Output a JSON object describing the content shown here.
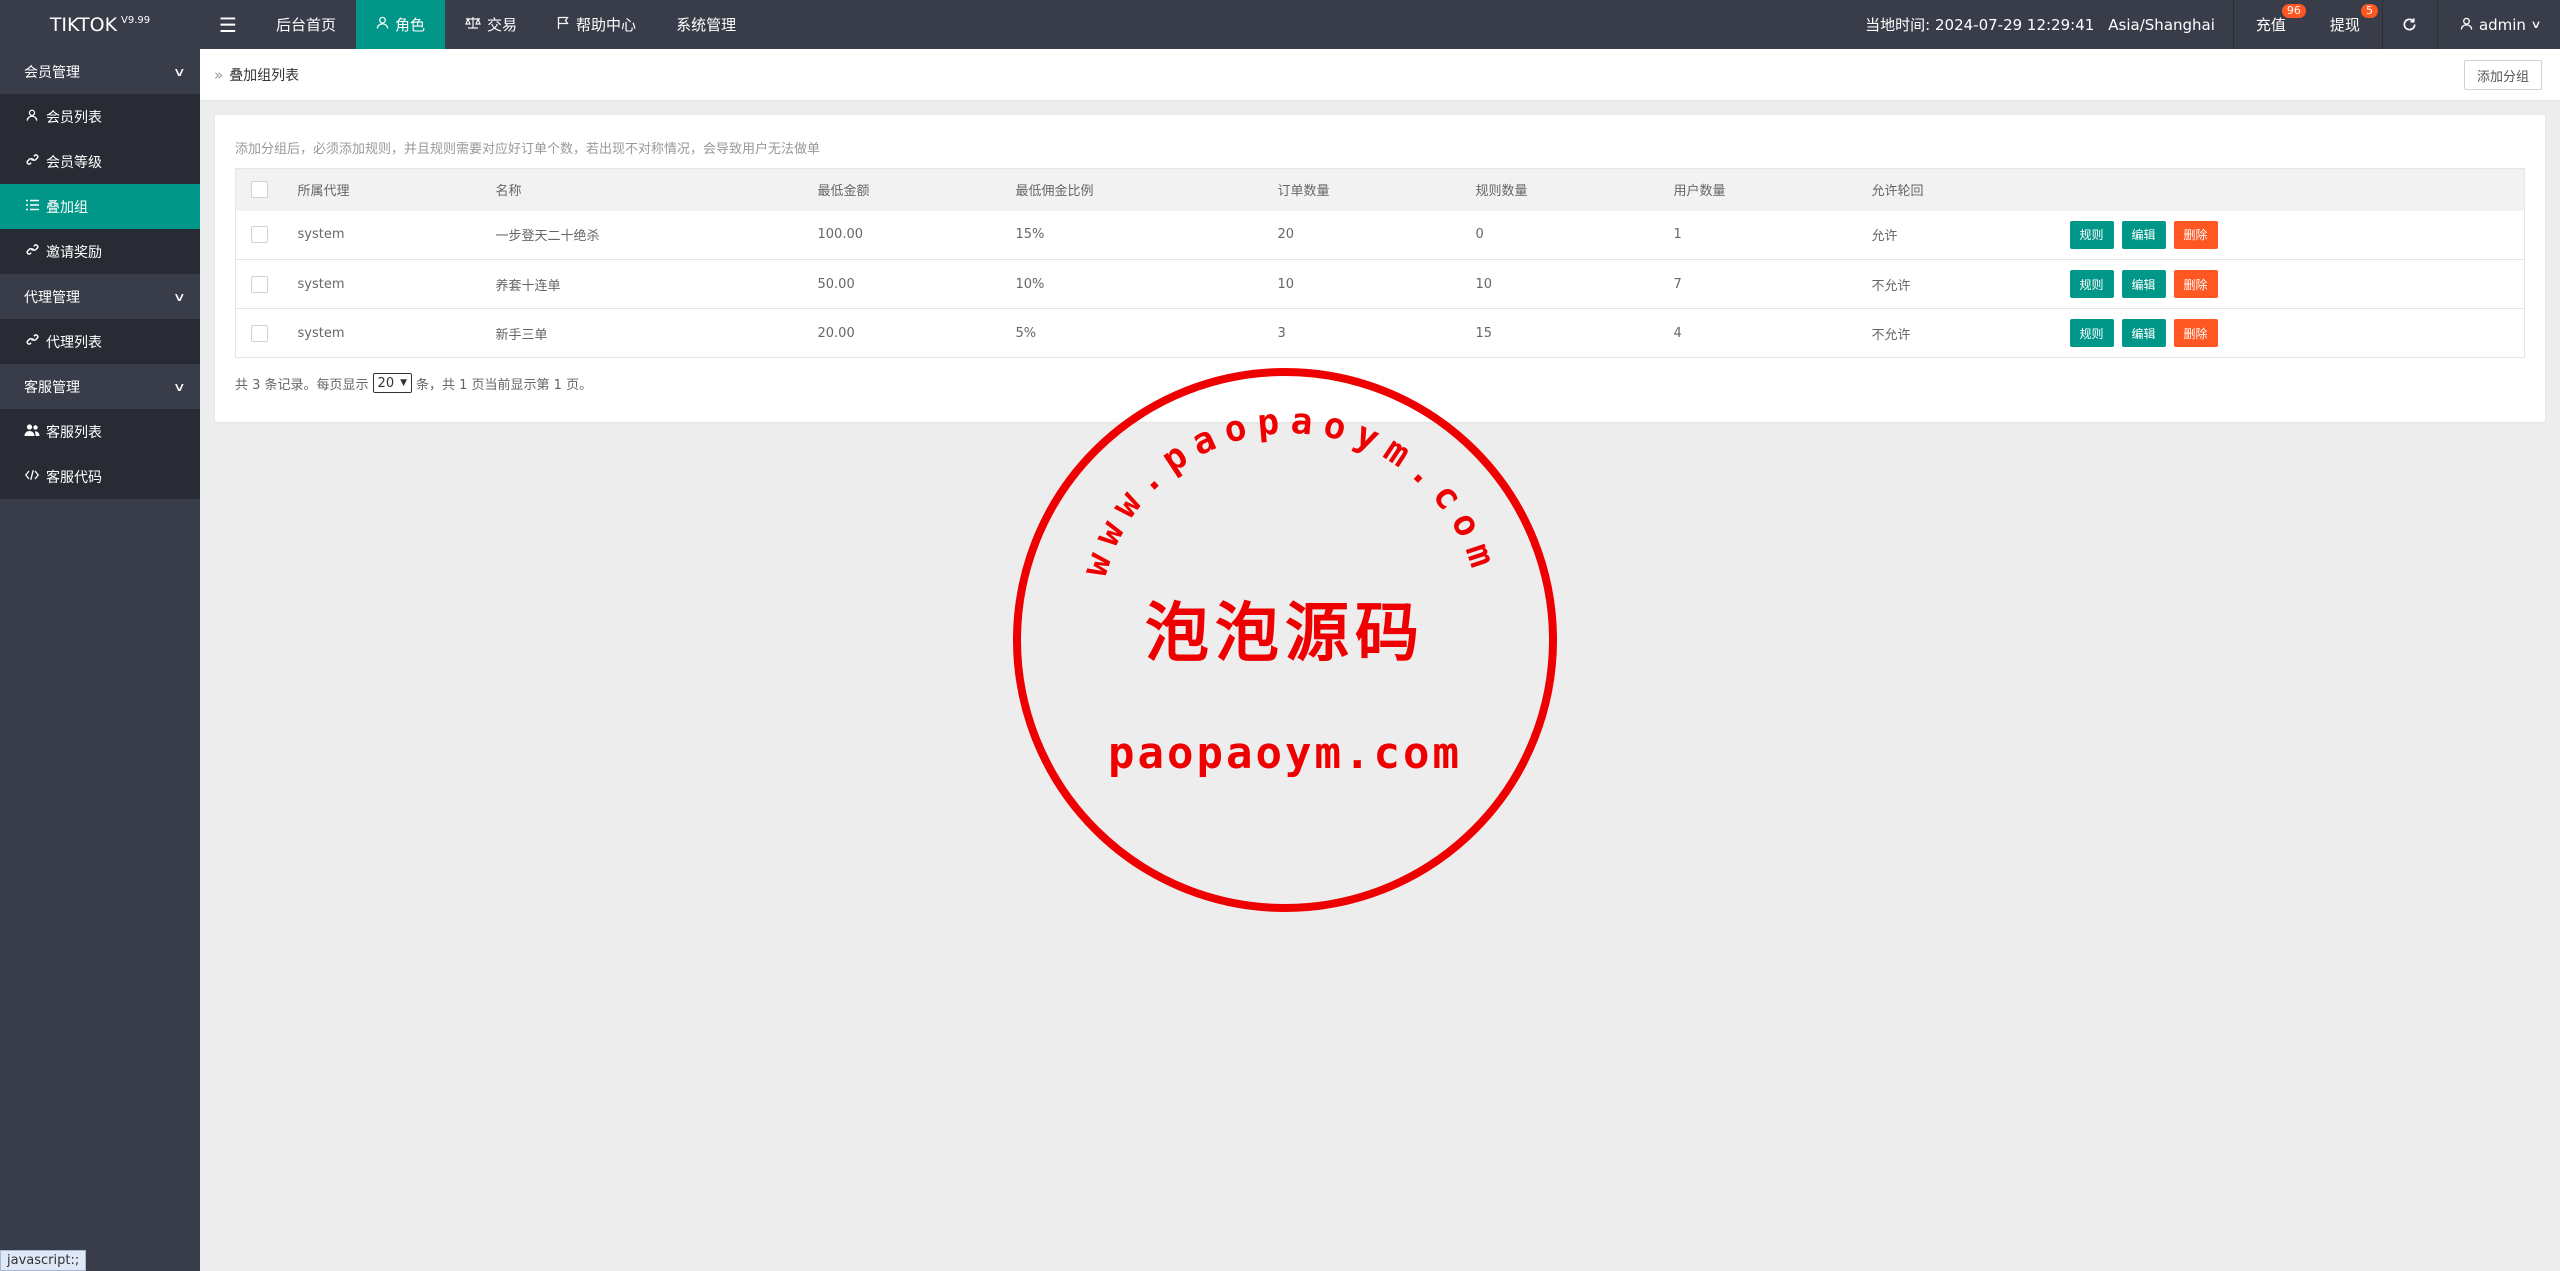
{
  "app": {
    "title": "TIKTOK",
    "version": "V9.99"
  },
  "topnav": {
    "items": [
      {
        "label": "后台首页",
        "icon": "home",
        "active": false
      },
      {
        "label": "角色",
        "icon": "user-icon",
        "active": true
      },
      {
        "label": "交易",
        "icon": "scale-icon",
        "active": false
      },
      {
        "label": "帮助中心",
        "icon": "flag-icon",
        "active": false
      },
      {
        "label": "系统管理",
        "icon": "",
        "active": false
      }
    ]
  },
  "header_right": {
    "time_label": "当地时间: 2024-07-29 12:29:41",
    "timezone": "Asia/Shanghai",
    "recharge": {
      "label": "充值",
      "count": "96"
    },
    "withdraw": {
      "label": "提现",
      "count": "5"
    },
    "user": "admin"
  },
  "sidebar": {
    "groups": [
      {
        "label": "会员管理",
        "items": [
          {
            "label": "会员列表",
            "icon": "user-icon",
            "active": false
          },
          {
            "label": "会员等级",
            "icon": "link-icon",
            "active": false
          },
          {
            "label": "叠加组",
            "icon": "list-icon",
            "active": true
          },
          {
            "label": "邀请奖励",
            "icon": "link-icon",
            "active": false
          }
        ]
      },
      {
        "label": "代理管理",
        "items": [
          {
            "label": "代理列表",
            "icon": "link-icon",
            "active": false
          }
        ]
      },
      {
        "label": "客服管理",
        "items": [
          {
            "label": "客服列表",
            "icon": "users-icon",
            "active": false
          },
          {
            "label": "客服代码",
            "icon": "code-icon",
            "active": false
          }
        ]
      }
    ]
  },
  "breadcrumb": {
    "title": "叠加组列表",
    "add_button": "添加分组"
  },
  "tip": "添加分组后，必须添加规则，并且规则需要对应好订单个数，若出现不对称情况，会导致用户无法做单",
  "table": {
    "headers": [
      "所属代理",
      "名称",
      "最低金额",
      "最低佣金比例",
      "订单数量",
      "规则数量",
      "用户数量",
      "允许轮回"
    ],
    "rows": [
      [
        "system",
        "一步登天二十绝杀",
        "100.00",
        "15%",
        "20",
        "0",
        "1",
        "允许"
      ],
      [
        "system",
        "养套十连单",
        "50.00",
        "10%",
        "10",
        "10",
        "7",
        "不允许"
      ],
      [
        "system",
        "新手三单",
        "20.00",
        "5%",
        "3",
        "15",
        "4",
        "不允许"
      ]
    ],
    "row_actions": [
      "规则",
      "编辑",
      "删除"
    ]
  },
  "pager": {
    "prefix": "共 3 条记录。每页显示",
    "page_size": "20",
    "suffix": "条，共 1 页当前显示第 1 页。"
  },
  "watermark": {
    "arc_text": "www.paopaoym.com",
    "center_text": "泡泡源码",
    "bottom_text": "paopaoym.com",
    "color": "#ee0000"
  },
  "status_tip": "javascript:;",
  "colors": {
    "primary": "#009688",
    "danger": "#ff5722",
    "dark": "#393d49"
  }
}
